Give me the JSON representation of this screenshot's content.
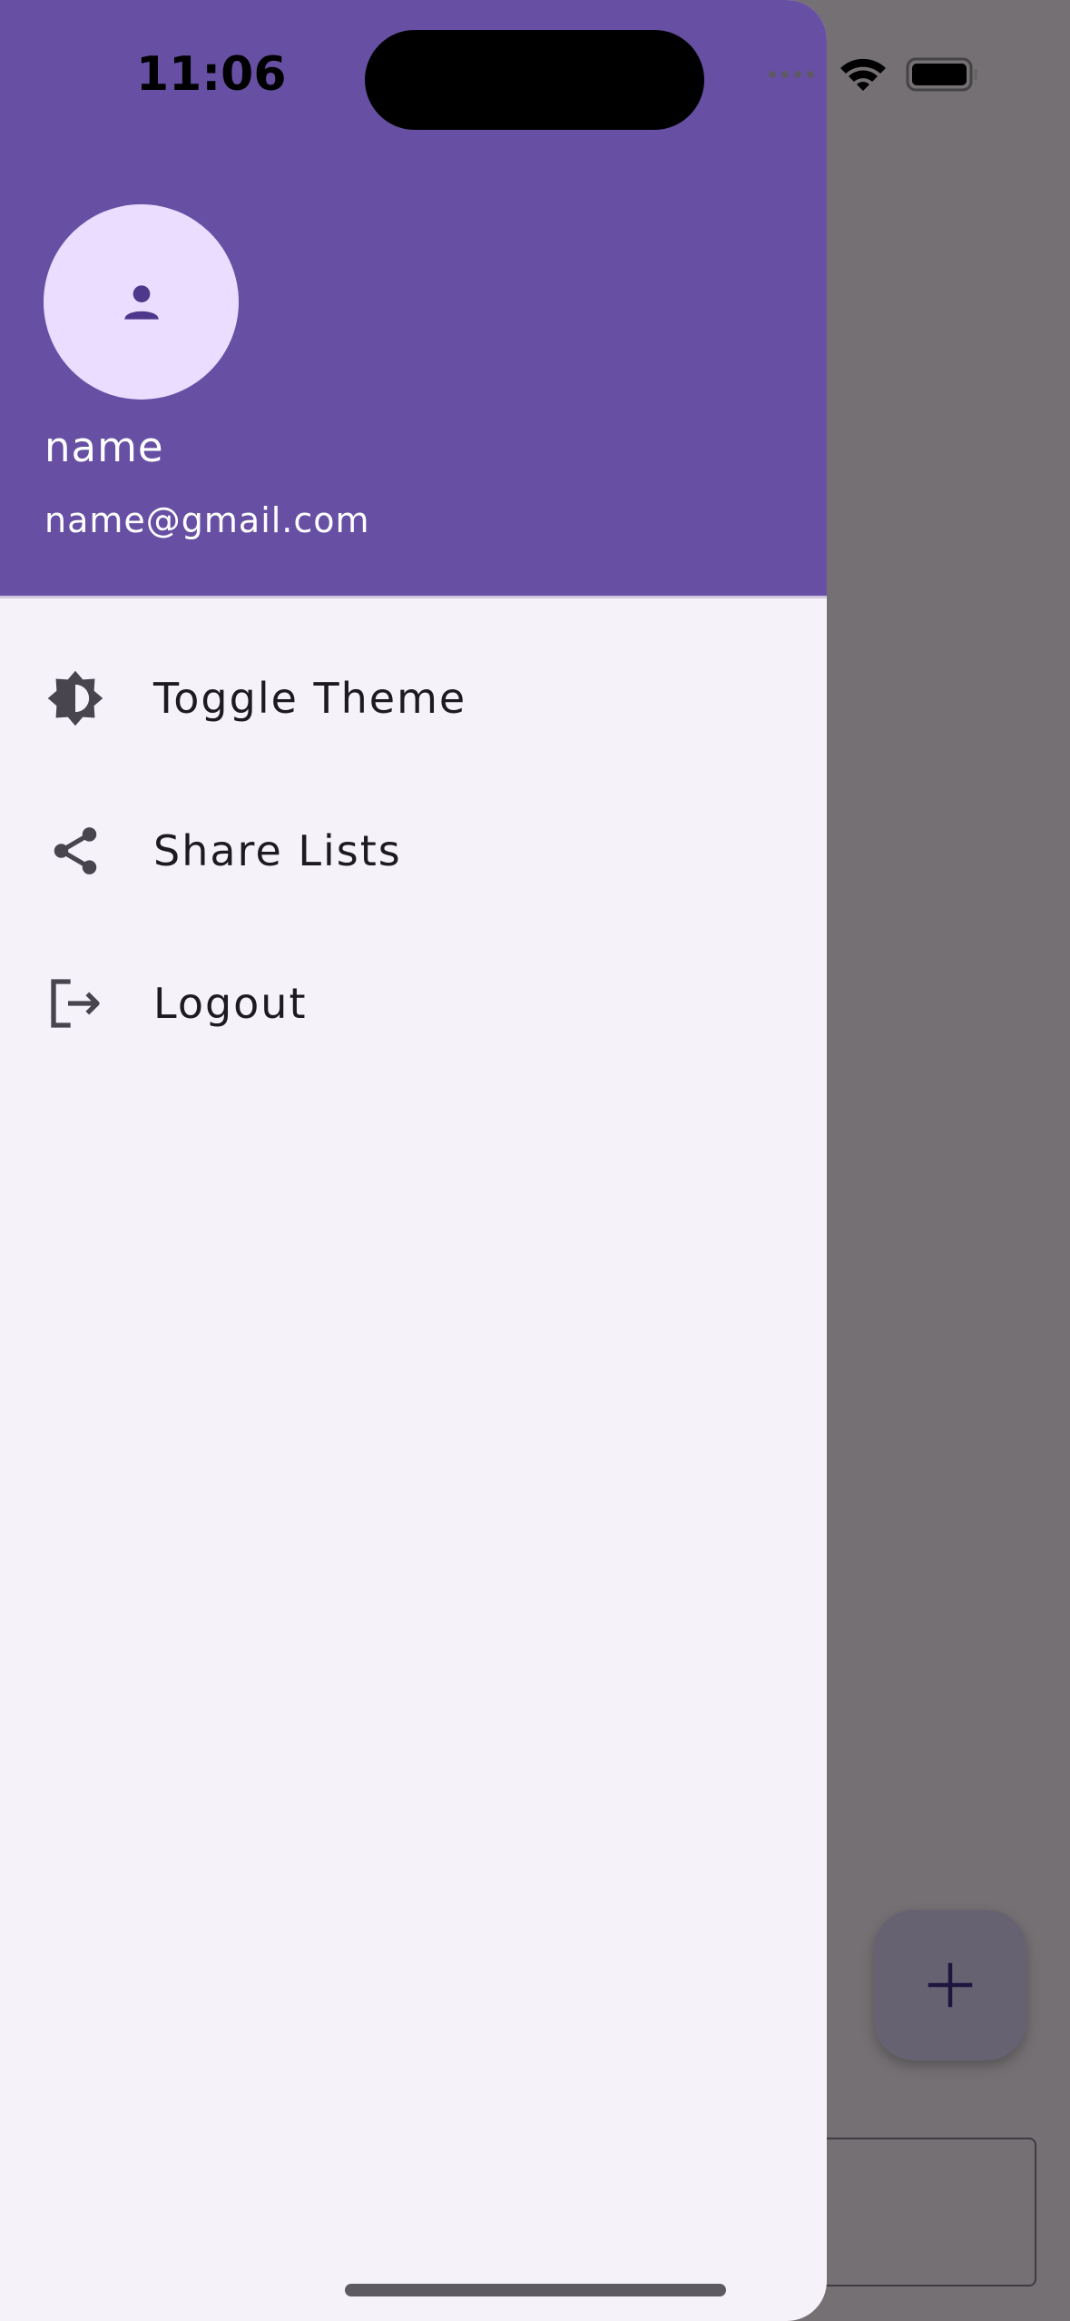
{
  "status_bar": {
    "time": "11:06"
  },
  "drawer": {
    "header": {
      "avatar_icon": "person-icon",
      "name": "name",
      "email": "name@gmail.com"
    },
    "items": [
      {
        "label": "Toggle Theme",
        "icon": "brightness-icon"
      },
      {
        "label": "Share Lists",
        "icon": "share-icon"
      },
      {
        "label": "Logout",
        "icon": "logout-icon"
      }
    ]
  },
  "fab": {
    "icon": "plus-icon"
  },
  "colors": {
    "header": "#6750a4",
    "drawer_bg": "#f6f2f9",
    "scrim": "#747073",
    "avatar_bg": "#eaddff"
  }
}
